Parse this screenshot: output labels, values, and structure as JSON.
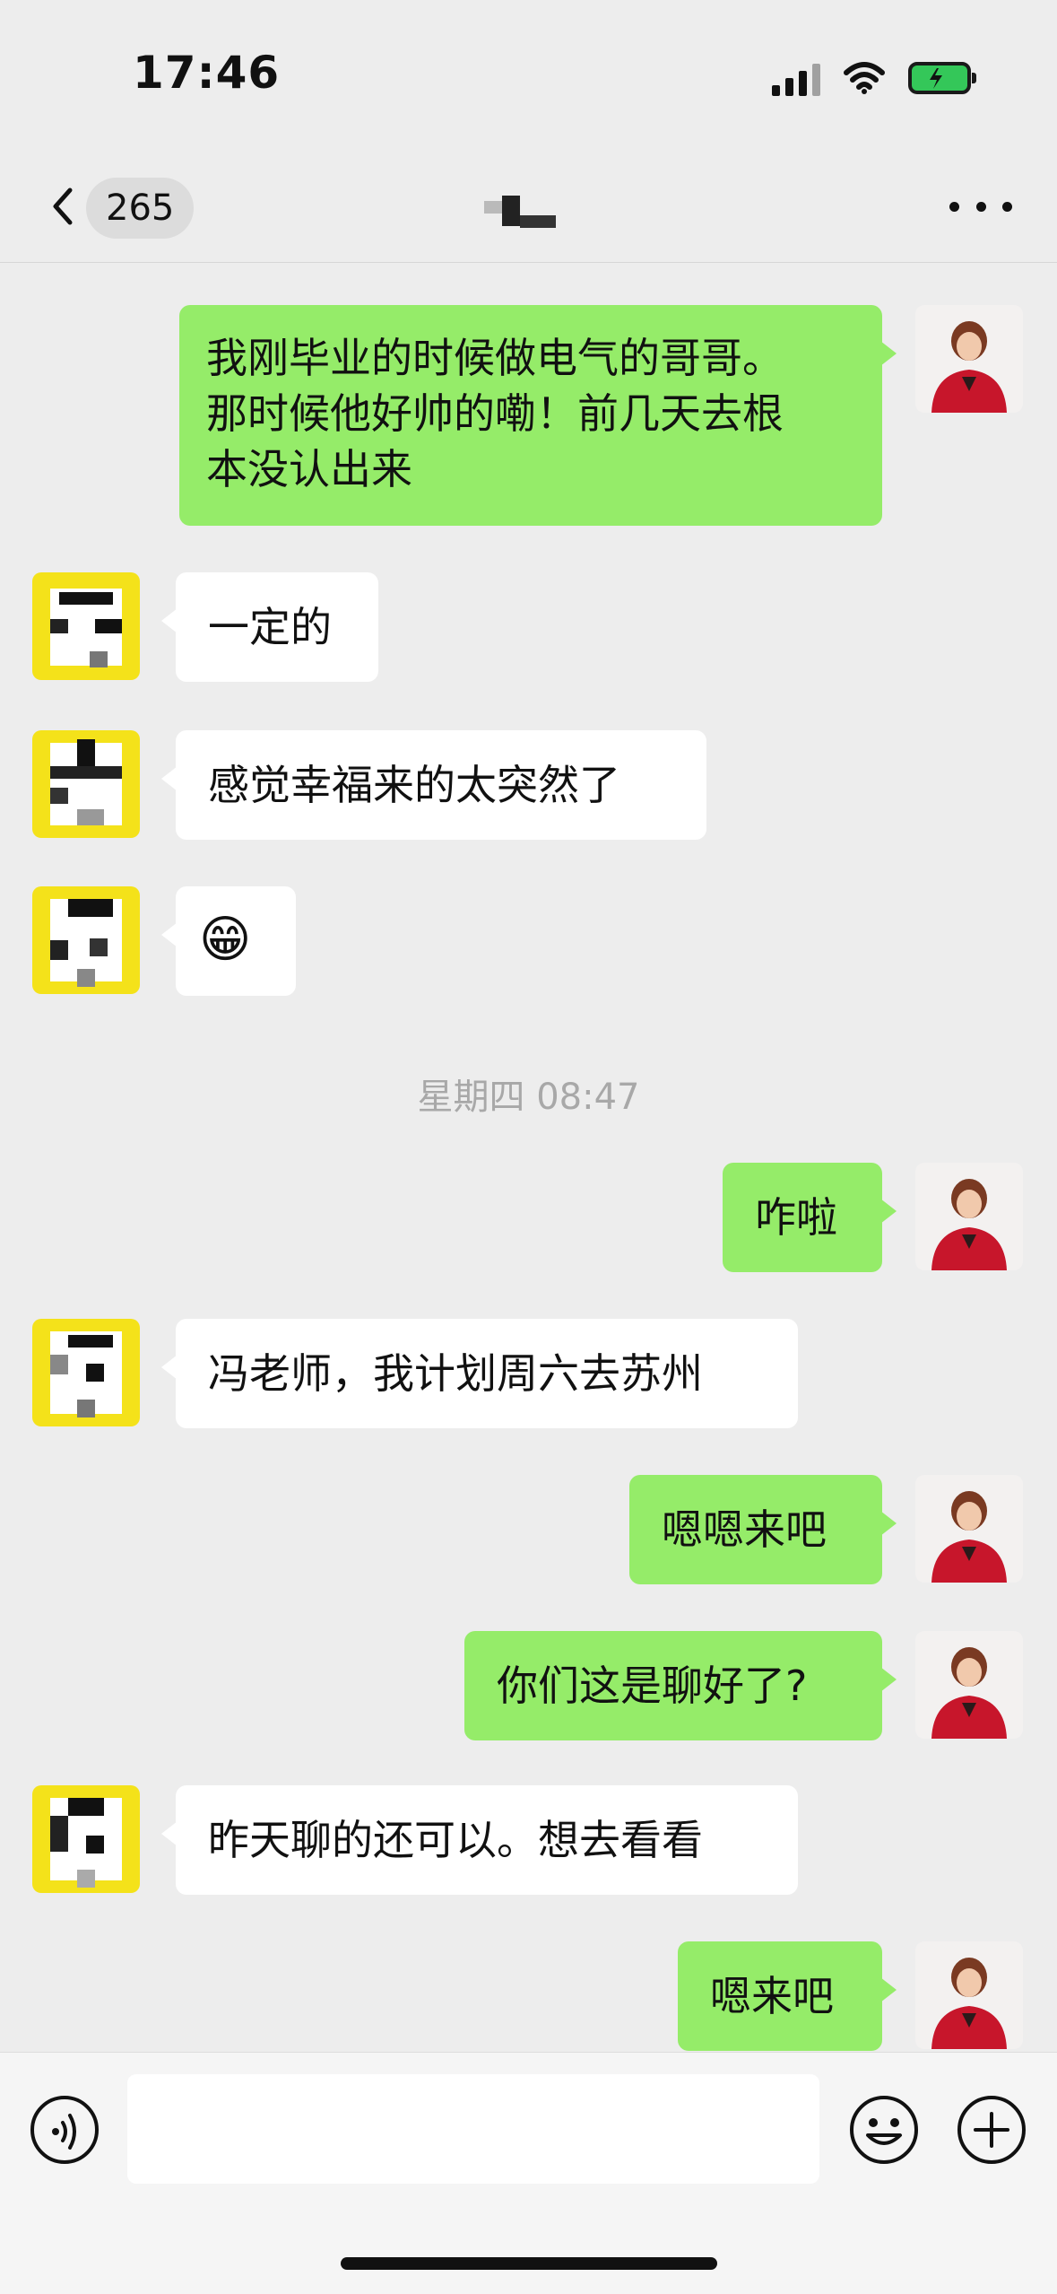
{
  "status_bar": {
    "time": "17:46",
    "battery": "charging"
  },
  "nav": {
    "unread_count": "265",
    "title": ""
  },
  "messages": [
    {
      "side": "sent",
      "text": "我刚毕业的时候做电气的哥哥。\n那时候他好帅的嘞！前几天去根\n本没认出来"
    },
    {
      "side": "recv",
      "text": "一定的"
    },
    {
      "side": "recv",
      "text": "感觉幸福来的太突然了"
    },
    {
      "side": "recv",
      "text": "😁"
    },
    {
      "side": "sent",
      "text": "咋啦"
    },
    {
      "side": "recv",
      "text": "冯老师，我计划周六去苏州"
    },
    {
      "side": "sent",
      "text": "嗯嗯来吧"
    },
    {
      "side": "sent",
      "text": "你们这是聊好了?"
    },
    {
      "side": "recv",
      "text": "昨天聊的还可以。想去看看"
    },
    {
      "side": "sent",
      "text": "嗯来吧"
    }
  ],
  "timestamp": "星期四 08:47",
  "input": {
    "value": "",
    "placeholder": ""
  },
  "icons": {
    "back": "chevron-left-icon",
    "more": "ellipsis-icon",
    "voice": "voice-icon",
    "emoji": "smile-icon",
    "plus": "plus-icon"
  },
  "colors": {
    "sent_bubble": "#95ec69",
    "recv_bubble": "#ffffff",
    "background": "#ededed"
  }
}
